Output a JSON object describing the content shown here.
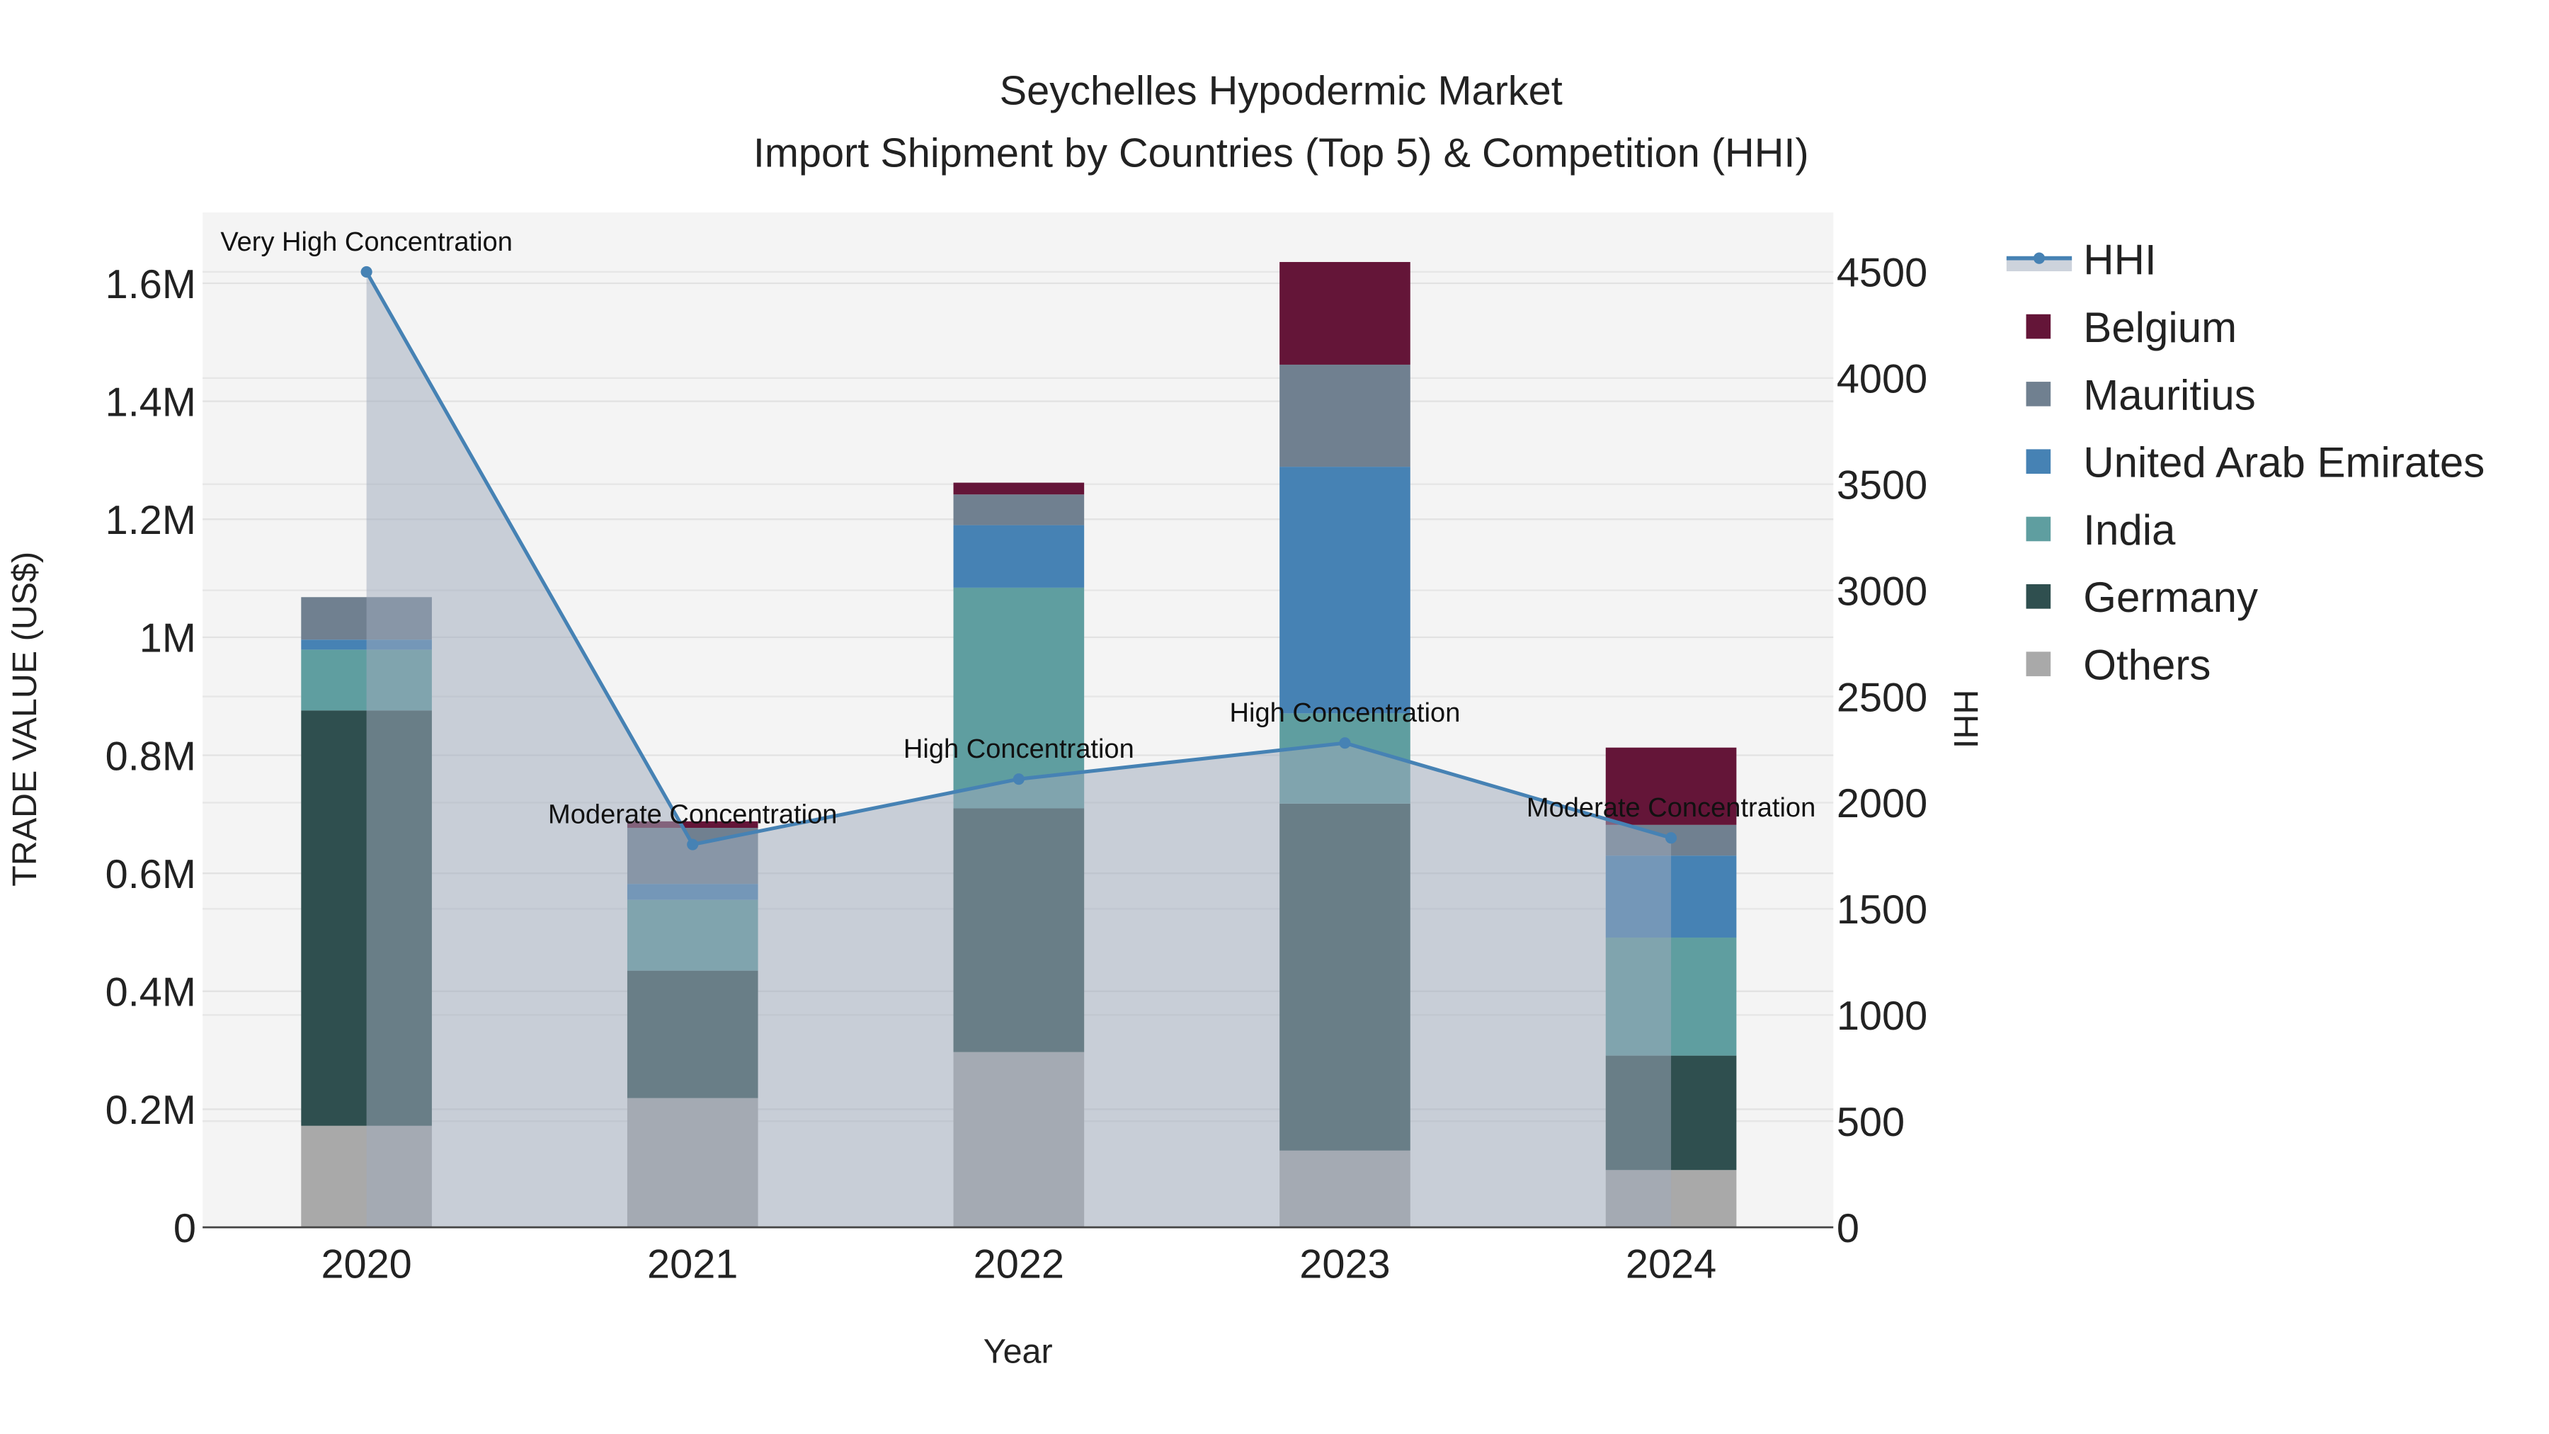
{
  "chart_data": {
    "type": "bar",
    "stacked": true,
    "title": "Seychelles Hypodermic Market",
    "subtitle": "Import Shipment by Countries (Top 5) & Competition (HHI)",
    "xlabel": "Year",
    "ylabel": "TRADE VALUE (US$)",
    "y2label": "HHI",
    "categories": [
      "2020",
      "2021",
      "2022",
      "2023",
      "2024"
    ],
    "ylim": [
      0,
      1720000
    ],
    "y2lim": [
      0,
      4780
    ],
    "yticks": [
      0,
      200000,
      400000,
      600000,
      800000,
      1000000,
      1200000,
      1400000,
      1600000
    ],
    "ytick_labels": [
      "0",
      "0.2M",
      "0.4M",
      "0.6M",
      "0.8M",
      "1M",
      "1.2M",
      "1.4M",
      "1.6M"
    ],
    "y2ticks": [
      0,
      500,
      1000,
      1500,
      2000,
      2500,
      3000,
      3500,
      4000,
      4500
    ],
    "y2tick_labels": [
      "0",
      "500",
      "1000",
      "1500",
      "2000",
      "2500",
      "3000",
      "3500",
      "4000",
      "4500"
    ],
    "series": [
      {
        "name": "Others",
        "color": "#A9A9A9",
        "values": [
          172000,
          219000,
          297000,
          130000,
          97000
        ]
      },
      {
        "name": "Germany",
        "color": "#2F4F4F",
        "values": [
          704000,
          216000,
          413000,
          588000,
          194000
        ]
      },
      {
        "name": "India",
        "color": "#5F9EA0",
        "values": [
          103000,
          120000,
          374000,
          153000,
          200000
        ]
      },
      {
        "name": "United Arab Emirates",
        "color": "#4682B4",
        "values": [
          17000,
          27000,
          106000,
          418000,
          139000
        ]
      },
      {
        "name": "Mauritius",
        "color": "#708090",
        "values": [
          72000,
          95000,
          52000,
          173000,
          52000
        ]
      },
      {
        "name": "Belgium",
        "color": "#641538",
        "values": [
          0,
          11000,
          20000,
          174000,
          131000
        ]
      }
    ],
    "hhi": {
      "name": "HHI",
      "color": "#4682B4",
      "values": [
        4500,
        1803,
        2111,
        2281,
        1834
      ],
      "annotations": [
        "Very High Concentration",
        "Moderate Concentration",
        "High Concentration",
        "High Concentration",
        "Moderate Concentration"
      ]
    },
    "legend_order": [
      "HHI",
      "Belgium",
      "Mauritius",
      "United Arab Emirates",
      "India",
      "Germany",
      "Others"
    ],
    "legend_placement": "right",
    "grid": true
  }
}
